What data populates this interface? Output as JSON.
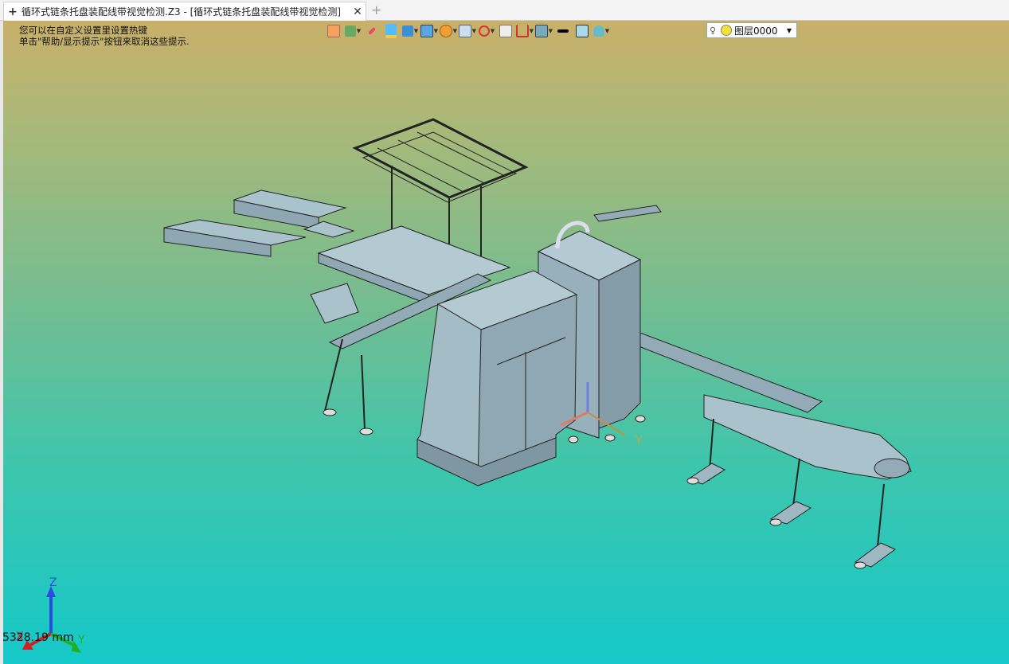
{
  "tab": {
    "title": "循环式链条托盘装配线带视觉检测.Z3 - [循环式链条托盘装配线带视觉检测]",
    "new_tab": "+",
    "close": "✕",
    "add": "+"
  },
  "hint": {
    "line1": "您可以在自定义设置里设置热键",
    "line2": "单击\"帮助/显示提示\"按钮来取消这些提示."
  },
  "layer": {
    "name": "图层0000"
  },
  "toolbar": {
    "icons": [
      "view-icon",
      "paint-icon",
      "edit-icon",
      "solid-icon",
      "cube-icon",
      "box-icon",
      "render-icon",
      "orient-icon",
      "section-icon",
      "frame-icon",
      "dimension-icon",
      "display-icon",
      "line-color-icon",
      "fill-color-icon",
      "layer-icon"
    ],
    "colors": {
      "line": "#000000",
      "fill": "#a8d8ea"
    }
  },
  "axes": {
    "x": "X",
    "y": "Y",
    "z": "Z"
  },
  "scale_text": "5328.19 mm"
}
